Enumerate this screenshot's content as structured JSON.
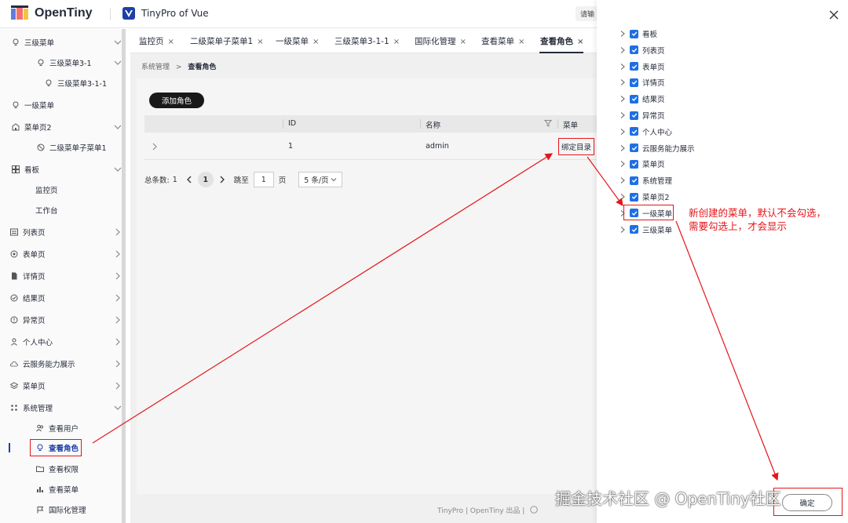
{
  "header": {
    "logo_text": "OpenTiny",
    "product_name": "TinyPro of Vue",
    "lang_button": "请输"
  },
  "sidebar": {
    "items": [
      {
        "label": "三级菜单",
        "icon": "bulb-icon",
        "expanded": true
      },
      {
        "label": "三级菜单3-1",
        "icon": "bulb-icon",
        "expanded": true
      },
      {
        "label": "三级菜单3-1-1",
        "icon": "bulb-icon"
      },
      {
        "label": "一级菜单",
        "icon": "bulb-icon"
      },
      {
        "label": "菜单页2",
        "icon": "building-icon",
        "expanded": true
      },
      {
        "label": "二级菜单子菜单1",
        "icon": "no-entry-icon"
      },
      {
        "label": "看板",
        "icon": "grid-icon",
        "expanded": true
      },
      {
        "label": "监控页"
      },
      {
        "label": "工作台"
      },
      {
        "label": "列表页",
        "icon": "list-icon"
      },
      {
        "label": "表单页",
        "icon": "target-icon"
      },
      {
        "label": "详情页",
        "icon": "doc-icon"
      },
      {
        "label": "结果页",
        "icon": "check-circle-icon"
      },
      {
        "label": "异常页",
        "icon": "alert-circle-icon"
      },
      {
        "label": "个人中心",
        "icon": "user-icon"
      },
      {
        "label": "云服务能力展示",
        "icon": "cloud-icon"
      },
      {
        "label": "菜单页",
        "icon": "layers-icon"
      },
      {
        "label": "系统管理",
        "icon": "grid-dots-icon",
        "expanded": true
      },
      {
        "label": "查看用户",
        "icon": "users-icon"
      },
      {
        "label": "查看角色",
        "icon": "bulb-icon",
        "active": true
      },
      {
        "label": "查看权限",
        "icon": "folder-icon"
      },
      {
        "label": "查看菜单",
        "icon": "bar-chart-icon"
      },
      {
        "label": "国际化管理",
        "icon": "flag-icon"
      }
    ]
  },
  "tabs": [
    {
      "label": "监控页",
      "close": "×"
    },
    {
      "label": "二级菜单子菜单1",
      "close": "×"
    },
    {
      "label": "一级菜单",
      "close": "×"
    },
    {
      "label": "三级菜单3-1-1",
      "close": "×"
    },
    {
      "label": "国际化管理",
      "close": "×"
    },
    {
      "label": "查看菜单",
      "close": "×"
    },
    {
      "label": "查看角色",
      "close": "×",
      "active": true
    }
  ],
  "breadcrumb": {
    "parent": "系统管理",
    "separator": ">",
    "current": "查看角色"
  },
  "add_role_button": "添加角色",
  "table": {
    "columns": [
      "ID",
      "名称",
      "菜单"
    ],
    "rows": [
      {
        "id": "1",
        "name": "admin",
        "action": "绑定目录"
      }
    ]
  },
  "pagination": {
    "total_label": "总条数:",
    "total": "1",
    "current_page": "1",
    "goto_label": "跳至",
    "goto_value": "1",
    "page_unit": "页",
    "page_size": "5 条/页"
  },
  "footer": {
    "text": "TinyPro | OpenTiny 出品 |"
  },
  "drawer": {
    "tree": [
      "看板",
      "列表页",
      "表单页",
      "详情页",
      "结果页",
      "异常页",
      "个人中心",
      "云服务能力展示",
      "菜单页",
      "系统管理",
      "菜单页2",
      "一级菜单",
      "三级菜单"
    ],
    "confirm_button": "确定"
  },
  "annotation": {
    "line1": "新创建的菜单，默认不会勾选，",
    "line2": "需要勾选上，才会显示"
  },
  "watermark": "掘金技术社区 @ OpenTiny社区",
  "colors": {
    "annotation_red": "#e5151a",
    "checkbox_blue": "#1e6fe5",
    "brand_dark": "#252b3a",
    "brand_blue": "#1d3fa8"
  }
}
